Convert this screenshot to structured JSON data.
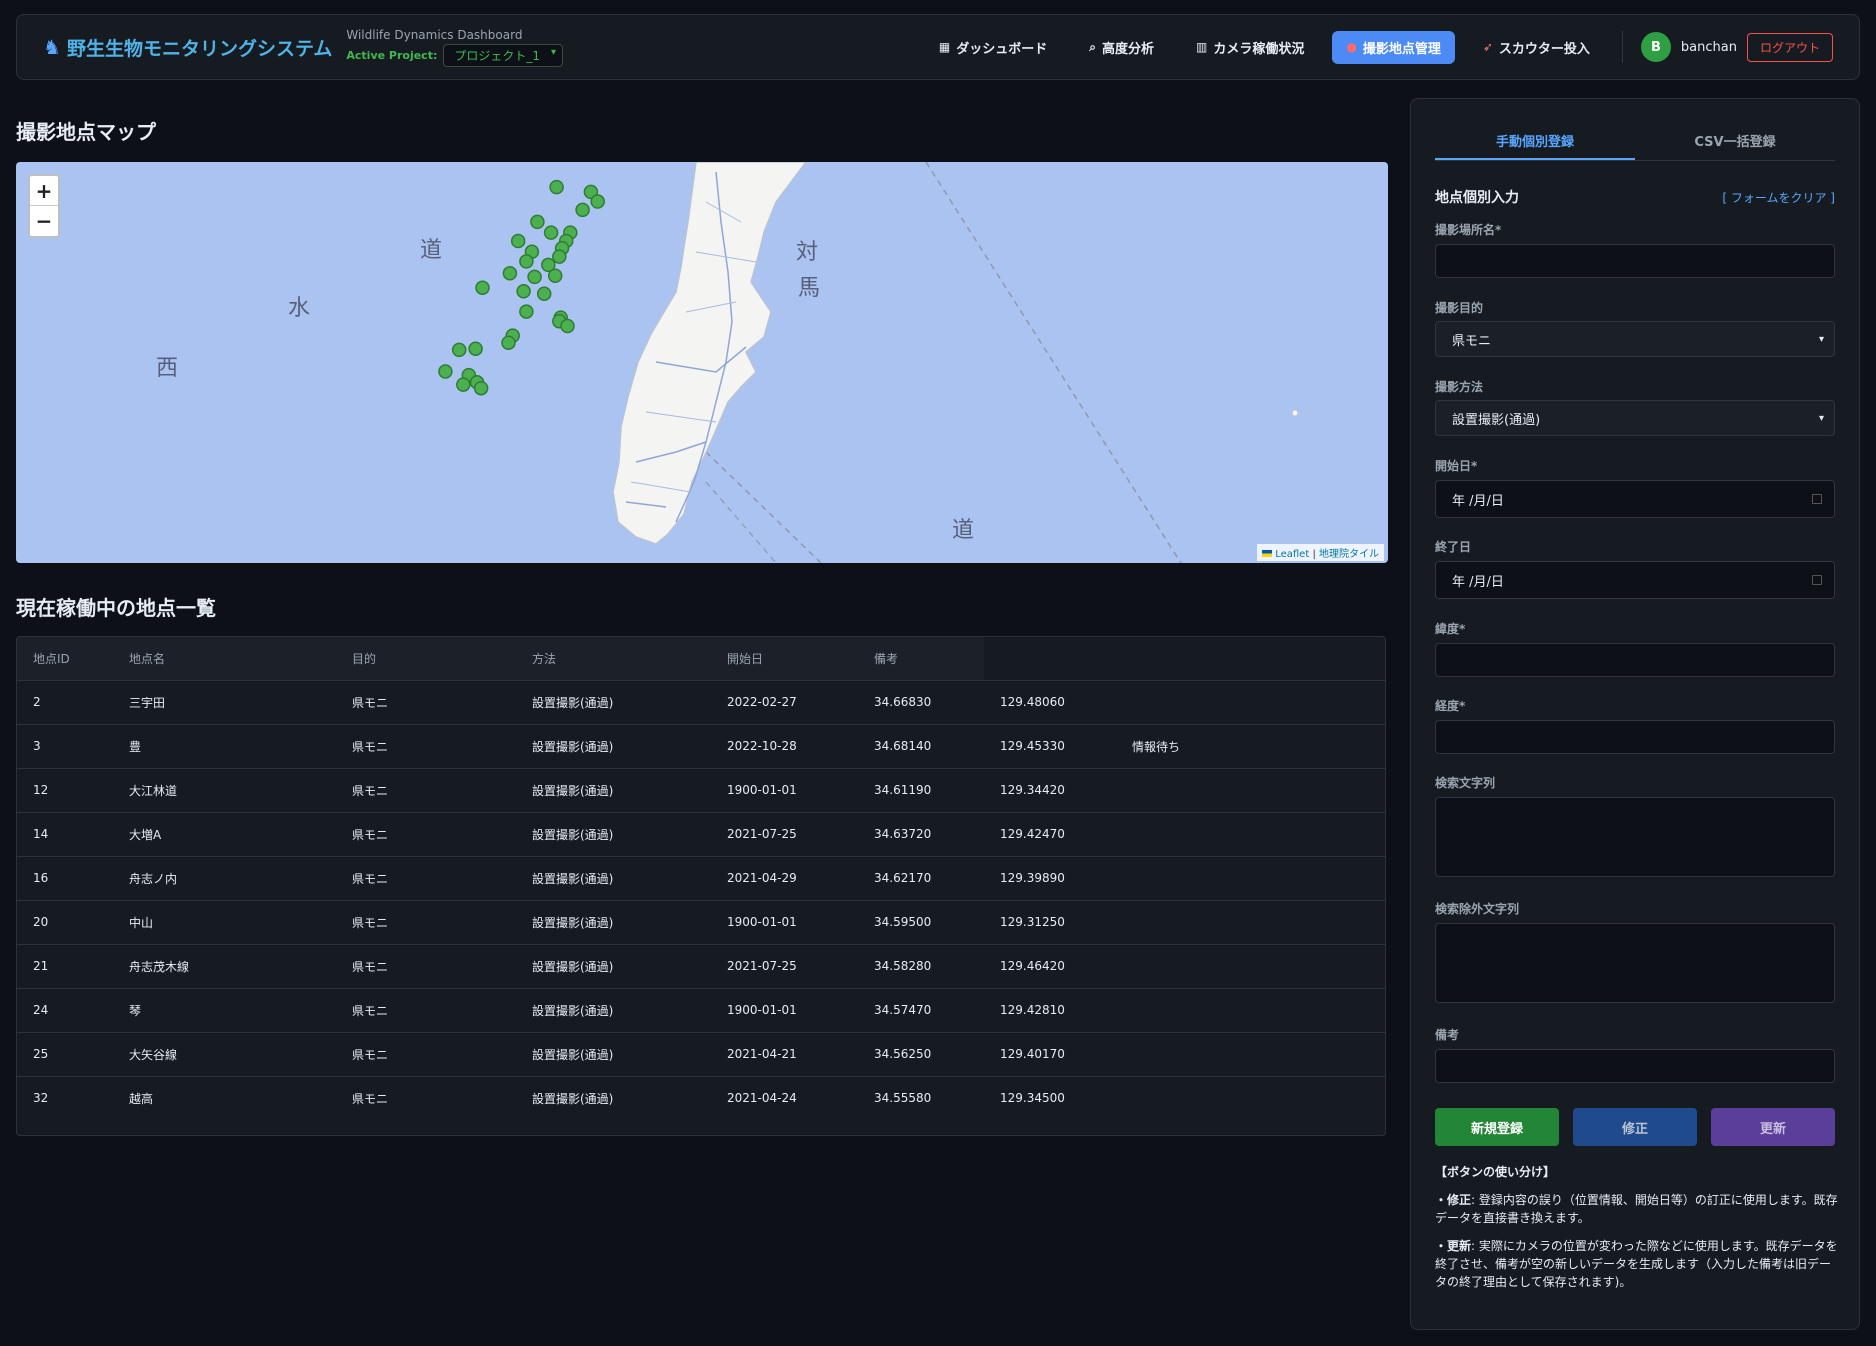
{
  "header": {
    "app_title": "野生生物モニタリングシステム",
    "subtitle": "Wildlife Dynamics Dashboard",
    "project_label": "Active Project:",
    "project_value": "プロジェクト_1",
    "nav": [
      {
        "label": "ダッシュボード",
        "icon": "dashboard-icon"
      },
      {
        "label": "高度分析",
        "icon": "search-icon"
      },
      {
        "label": "カメラ稼働状況",
        "icon": "bar-chart-icon"
      },
      {
        "label": "撮影地点管理",
        "icon": "pin-icon",
        "active": true
      },
      {
        "label": "スカウター投入",
        "icon": "rocket-icon"
      }
    ],
    "user_initial": "B",
    "username": "banchan",
    "logout_label": "ログアウト"
  },
  "map_section": {
    "title": "撮影地点マップ",
    "zoom_in": "+",
    "zoom_out": "−",
    "attribution_leaflet": "Leaflet",
    "attribution_sep": " | ",
    "attribution_tiles": "地理院タイル",
    "labels": [
      "道",
      "水",
      "西",
      "対",
      "馬",
      "道"
    ]
  },
  "table_section": {
    "title": "現在稼働中の地点一覧",
    "columns": [
      "地点ID",
      "地点名",
      "目的",
      "方法",
      "開始日",
      "備考"
    ],
    "rows": [
      [
        "2",
        "三宇田",
        "県モニ",
        "設置撮影(通過)",
        "2022-02-27",
        "34.66830",
        "129.48060",
        ""
      ],
      [
        "3",
        "豊",
        "県モニ",
        "設置撮影(通過)",
        "2022-10-28",
        "34.68140",
        "129.45330",
        "情報待ち"
      ],
      [
        "12",
        "大江林道",
        "県モニ",
        "設置撮影(通過)",
        "1900-01-01",
        "34.61190",
        "129.34420",
        ""
      ],
      [
        "14",
        "大増A",
        "県モニ",
        "設置撮影(通過)",
        "2021-07-25",
        "34.63720",
        "129.42470",
        ""
      ],
      [
        "16",
        "舟志ノ内",
        "県モニ",
        "設置撮影(通過)",
        "2021-04-29",
        "34.62170",
        "129.39890",
        ""
      ],
      [
        "20",
        "中山",
        "県モニ",
        "設置撮影(通過)",
        "1900-01-01",
        "34.59500",
        "129.31250",
        ""
      ],
      [
        "21",
        "舟志茂木線",
        "県モニ",
        "設置撮影(通過)",
        "2021-07-25",
        "34.58280",
        "129.46420",
        ""
      ],
      [
        "24",
        "琴",
        "県モニ",
        "設置撮影(通過)",
        "1900-01-01",
        "34.57470",
        "129.42810",
        ""
      ],
      [
        "25",
        "大矢谷線",
        "県モニ",
        "設置撮影(通過)",
        "2021-04-21",
        "34.56250",
        "129.40170",
        ""
      ],
      [
        "32",
        "越高",
        "県モニ",
        "設置撮影(通過)",
        "2021-04-24",
        "34.55580",
        "129.34500",
        ""
      ]
    ]
  },
  "panel": {
    "tab_manual": "手動個別登録",
    "tab_csv": "CSV一括登録",
    "form_title": "地点個別入力",
    "clear_link": "[ フォームをクリア ]",
    "fields": {
      "place_name": "撮影場所名*",
      "purpose": "撮影目的",
      "purpose_value": "県モニ",
      "method": "撮影方法",
      "method_value": "設置撮影(通過)",
      "start": "開始日*",
      "start_value": "年 /月/日",
      "end": "終了日",
      "end_value": "年 /月/日",
      "lat": "緯度*",
      "lng": "経度*",
      "search": "検索文字列",
      "exclude": "検索除外文字列",
      "note": "備考"
    },
    "buttons": {
      "new": "新規登録",
      "fix": "修正",
      "update": "更新"
    },
    "help": {
      "title": "【ボタンの使い分け】",
      "fix_term": "・修正",
      "fix_text": ": 登録内容の誤り（位置情報、開始日等）の訂正に使用します。既存データを直接書き換えます。",
      "upd_term": "・更新",
      "upd_text": ": 実際にカメラの位置が変わった際などに使用します。既存データを終了させ、備考が空の新しいデータを生成します（入力した備考は旧データの終了理由として保存されます)。"
    }
  },
  "colors": {
    "accent": "#58a6ff",
    "active_nav": "#4c8bf5",
    "marker": "#4caf50",
    "new_button": "#238636",
    "fix_button": "#1f4a8c",
    "update_button": "#5b3d9a"
  }
}
